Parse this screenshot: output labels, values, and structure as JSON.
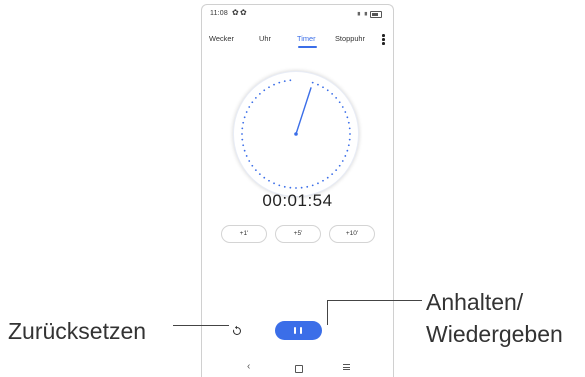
{
  "status_bar": {
    "time": "11:08",
    "icons": [
      "gear-icon",
      "gear-icon",
      "signal-icon",
      "battery-icon"
    ]
  },
  "tabs": [
    {
      "label": "Wecker",
      "active": false
    },
    {
      "label": "Uhr",
      "active": false
    },
    {
      "label": "Timer",
      "active": true
    },
    {
      "label": "Stoppuhr",
      "active": false
    }
  ],
  "timer": {
    "display": "00:01:54",
    "remaining_fraction": 0.95,
    "add_buttons": [
      "+1'",
      "+5'",
      "+10'"
    ]
  },
  "controls": {
    "reset_icon": "reset-icon",
    "pause_icon": "pause-icon"
  },
  "navbar": [
    "back-icon",
    "home-icon",
    "recents-icon"
  ],
  "callouts": {
    "left": "Zurücksetzen",
    "right_line1": "Anhalten/",
    "right_line2": "Wiedergeben"
  },
  "colors": {
    "accent": "#3b6ee8"
  }
}
